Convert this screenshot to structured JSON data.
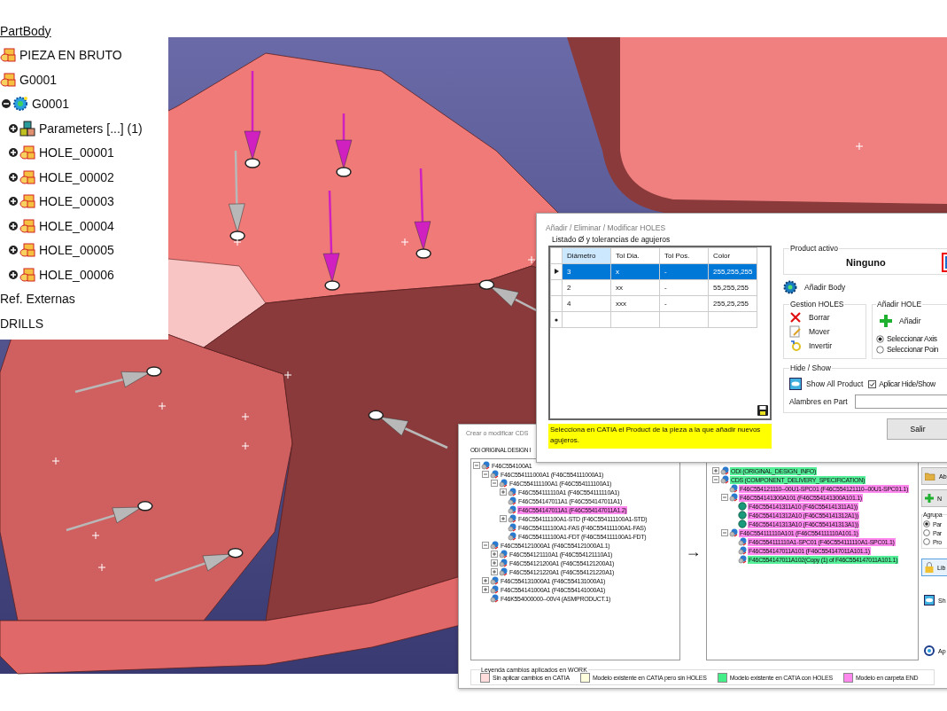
{
  "spec_tree": {
    "items": [
      {
        "label": "PartBody",
        "kind": "root",
        "children": [
          {
            "label": "PIEZA EN BRUTO",
            "kind": "body"
          },
          {
            "label": "G0001",
            "kind": "body"
          },
          {
            "label": "G0001",
            "kind": "geoset",
            "expanded": true,
            "children": [
              {
                "label": "Parameters [...] (1)",
                "kind": "parameters",
                "expanded": false
              },
              {
                "label": "HOLE_00001",
                "kind": "hole",
                "expanded": false
              },
              {
                "label": "HOLE_00002",
                "kind": "hole",
                "expanded": false
              },
              {
                "label": "HOLE_00003",
                "kind": "hole",
                "expanded": false
              },
              {
                "label": "HOLE_00004",
                "kind": "hole",
                "expanded": false
              },
              {
                "label": "HOLE_00005",
                "kind": "hole",
                "expanded": false
              },
              {
                "label": "HOLE_00006",
                "kind": "hole",
                "expanded": false
              }
            ]
          }
        ]
      },
      {
        "label": "Ref. Externas",
        "kind": "group"
      },
      {
        "label": "DRILLS",
        "kind": "group"
      }
    ]
  },
  "holes_dialog": {
    "title": "Añadir / Eliminar /  Modificar  HOLES",
    "list_label": "Listado Ø y tolerancias de agujeros",
    "columns": [
      {
        "label": "Diámetro",
        "selected": true
      },
      {
        "label": "Tol Dia.",
        "selected": false
      },
      {
        "label": "Tol Pos.",
        "selected": false
      },
      {
        "label": "Color",
        "selected": false
      }
    ],
    "rows": [
      {
        "cells": [
          "3",
          "x",
          "-",
          "255,255,255"
        ],
        "selected": true
      },
      {
        "cells": [
          "2",
          "xx",
          "-",
          "55,255,255"
        ],
        "selected": false
      },
      {
        "cells": [
          "4",
          "xxx",
          "-",
          "255,25,255"
        ],
        "selected": false
      }
    ],
    "message": "Selecciona en CATIA el Product de la pieza a la que añadir nuevos agujeros.",
    "product_group": {
      "label": "Product activo",
      "value": "Ninguno"
    },
    "add_body_button": "Añadir Body",
    "gestion_group": {
      "label": "Gestion HOLES",
      "buttons": [
        {
          "label": "Borrar",
          "kind": "delete"
        },
        {
          "label": "Mover",
          "kind": "edit"
        },
        {
          "label": "Invertir",
          "kind": "invert"
        }
      ]
    },
    "add_hole_group": {
      "label": "Añadir HOLE",
      "button": "Añadir",
      "options": [
        {
          "label": "Seleccionar Axis",
          "selected": true
        },
        {
          "label": "Seleccionar Poin",
          "selected": false
        }
      ]
    },
    "hide_show_group": {
      "label": "Hide / Show",
      "show_all_button": "Show All Product",
      "apply_checkbox": {
        "label": "Aplicar Hide/Show",
        "checked": true
      },
      "wires_label": "Alambres en Part"
    },
    "exit_button": "Salir"
  },
  "cds_dialog": {
    "title": "Crear o modificar CDS",
    "left_tree_label": "ODI ORIGINAL DESIGN I",
    "left_tree": [
      {
        "label": "F46C554100A1",
        "kind": "product",
        "expanded": true,
        "children": [
          {
            "label": "F46C554111000A1 (F46C554111000A1)",
            "kind": "product",
            "expanded": true,
            "children": [
              {
                "label": "F46C554111100A1 (F46C554111100A1)",
                "kind": "product",
                "expanded": true,
                "children": [
                  {
                    "label": "F46C554111110A1 (F46C554111110A1)",
                    "kind": "product",
                    "expanded": false
                  },
                  {
                    "label": "F46C554147011A1 (F46C554147011A1)",
                    "kind": "product"
                  },
                  {
                    "label": "F46C554147011A1 (F46C554147011A1.2)",
                    "kind": "product",
                    "color": "#ff88ee"
                  },
                  {
                    "label": "F46C554111100A1-STD (F46C554111100A1-STD)",
                    "kind": "product",
                    "expanded": false
                  },
                  {
                    "label": "F46C554111100A1-FAS (F46C554111100A1-FAS)",
                    "kind": "product"
                  },
                  {
                    "label": "F46C554111100A1-FDT (F46C554111100A1-FDT)",
                    "kind": "product"
                  }
                ]
              }
            ]
          },
          {
            "label": "F46C554121000A1 (F46C554121000A1.1)",
            "kind": "product",
            "expanded": true,
            "children": [
              {
                "label": "F46C554121110A1 (F46C554121110A1)",
                "kind": "product",
                "expanded": false
              },
              {
                "label": "F46C554121200A1 (F46C554121200A1)",
                "kind": "product",
                "expanded": false
              },
              {
                "label": "F46C554121220A1 (F46C554121220A1)",
                "kind": "product",
                "expanded": false
              }
            ]
          },
          {
            "label": "F46C554131000A1 (F46C554131000A1)",
            "kind": "product",
            "expanded": false
          },
          {
            "label": "F46C554141000A1 (F46C554141000A1)",
            "kind": "product",
            "expanded": false
          },
          {
            "label": "F46K554000000--00V4 (ASMPRODUCT.1)",
            "kind": "product"
          }
        ]
      }
    ],
    "arrow": "→",
    "right_tree": [
      {
        "label": "ODI (ORIGINAL_DESIGN_INFO)",
        "kind": "product",
        "expanded": false,
        "color": "#55ee99"
      },
      {
        "label": "CDS (COMPONENT_DELIVERY_SPECIFICATION)",
        "kind": "product",
        "expanded": true,
        "color": "#55ee99",
        "children": [
          {
            "label": "F46C554121110--00U1-SPC01 (F46C554121110--00U1-SPC01.1)",
            "kind": "product",
            "color": "#ff88ee"
          },
          {
            "label": "F46C554141300A101 (F46C554141300A101.1)",
            "kind": "product",
            "expanded": true,
            "color": "#ff88ee",
            "children": [
              {
                "label": "F46C554141311A10 (F46C554141311A1))",
                "kind": "part",
                "color": "#ff88ee"
              },
              {
                "label": "F46C554141312A10 (F46C554141312A1))",
                "kind": "part",
                "color": "#ff88ee"
              },
              {
                "label": "F46C554141313A10 (F46C554141313A1))",
                "kind": "part",
                "color": "#ff88ee"
              }
            ]
          },
          {
            "label": "F46C554111110A101 (F46C554111110A101.1)",
            "kind": "product",
            "expanded": true,
            "color": "#ff88ee",
            "children": [
              {
                "label": "F46C554111110A1-SPC01 (F46C554111110A1-SPC01.1)",
                "kind": "product",
                "color": "#ff88ee"
              },
              {
                "label": "F46C554147011A101 (F46C554147011A101.1)",
                "kind": "product",
                "color": "#ff88ee"
              },
              {
                "label": "F46C554147011A102(Copy (1) of F46C554147011A101.1)",
                "kind": "product",
                "color": "#55ee99"
              }
            ]
          }
        ]
      }
    ],
    "side_buttons": [
      {
        "label": "Ab",
        "kind": "open"
      },
      {
        "label": "N",
        "kind": "new"
      }
    ],
    "group_label": "Agrupa",
    "group_options": [
      {
        "label": "Par",
        "selected": true
      },
      {
        "label": "Par",
        "selected": false
      },
      {
        "label": "Pro",
        "selected": false
      }
    ],
    "lock_button": "Lib",
    "show_button": "Sh",
    "apply_button": "Ap",
    "legend": {
      "title": "Leyenda cambios aplicados en WORK",
      "items": [
        {
          "label": "Sin aplicar cambios en CATIA",
          "color": "#ffdddd"
        },
        {
          "label": "Modelo existente en CATIA pero sin HOLES",
          "color": "#ffffdd"
        },
        {
          "label": "Modelo existente en CATIA con HOLES",
          "color": "#44ee88"
        },
        {
          "label": "Modelo en carpeta END",
          "color": "#ff88ee"
        }
      ]
    }
  }
}
